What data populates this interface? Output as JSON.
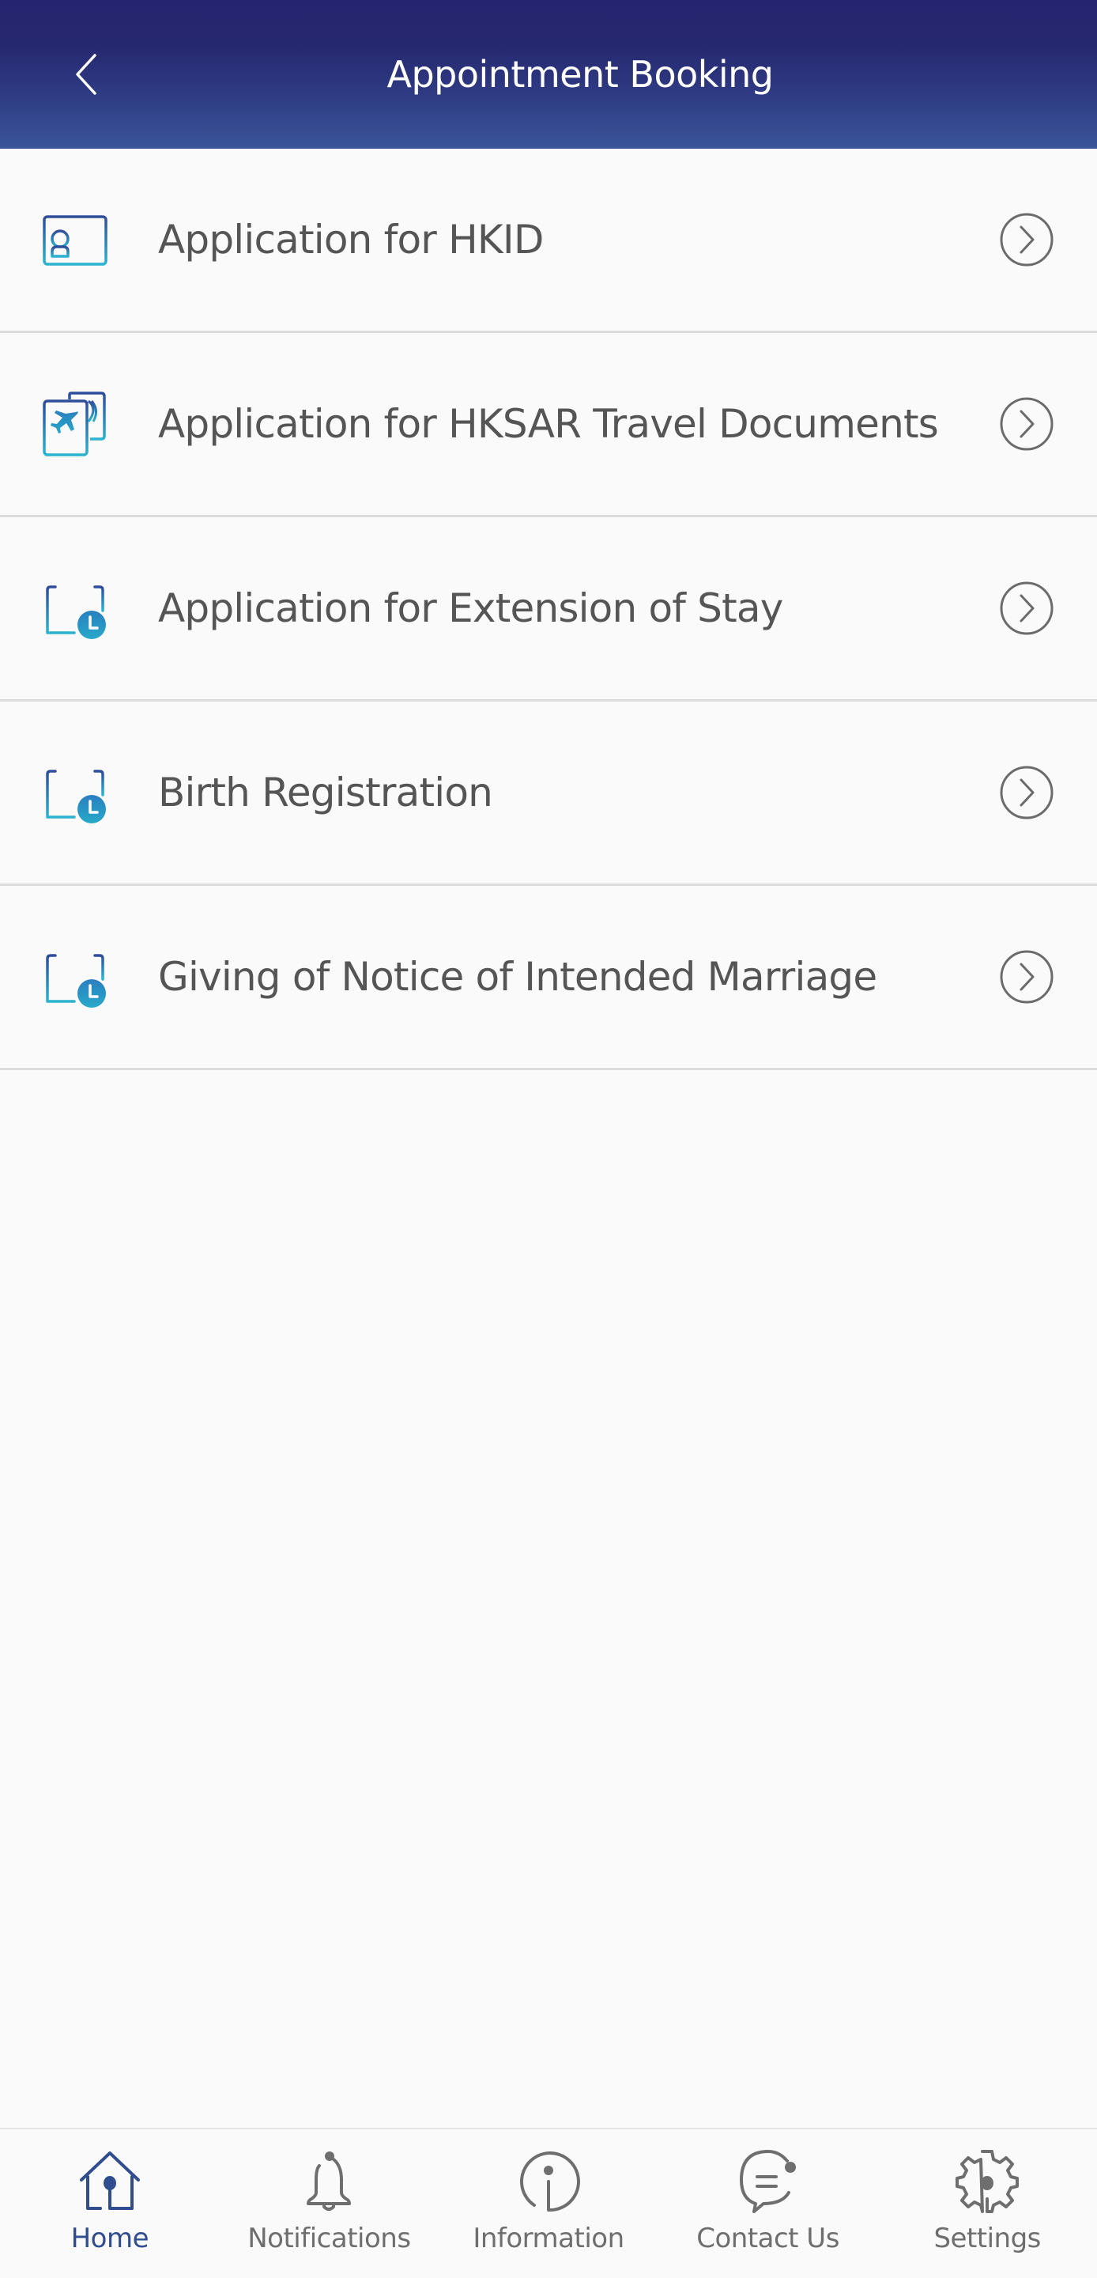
{
  "header": {
    "title": "Appointment Booking",
    "back_icon": "chevron-left-icon"
  },
  "list": {
    "items": [
      {
        "label": "Application for HKID",
        "icon": "id-card-icon"
      },
      {
        "label": "Application for HKSAR Travel Documents",
        "icon": "passport-icon"
      },
      {
        "label": "Application for Extension of Stay",
        "icon": "calendar-clock-icon"
      },
      {
        "label": "Birth Registration",
        "icon": "calendar-clock-icon"
      },
      {
        "label": "Giving of Notice of Intended Marriage",
        "icon": "calendar-clock-icon"
      }
    ],
    "trailing_icon": "chevron-right-circle-icon"
  },
  "bottom_nav": {
    "items": [
      {
        "label": "Home",
        "icon": "home-icon",
        "active": true
      },
      {
        "label": "Notifications",
        "icon": "bell-icon",
        "active": false
      },
      {
        "label": "Information",
        "icon": "info-icon",
        "active": false
      },
      {
        "label": "Contact Us",
        "icon": "chat-bubble-icon",
        "active": false
      },
      {
        "label": "Settings",
        "icon": "gear-icon",
        "active": false
      }
    ]
  },
  "colors": {
    "header_top": "#25256f",
    "header_bottom": "#3a5599",
    "icon_gradient_top": "#2f4d9a",
    "icon_gradient_bottom": "#2bb3cf",
    "nav_active": "#2f4d8f",
    "nav_inactive": "#6e6e6e",
    "row_text": "#555555",
    "divider": "#dcdcdc"
  }
}
